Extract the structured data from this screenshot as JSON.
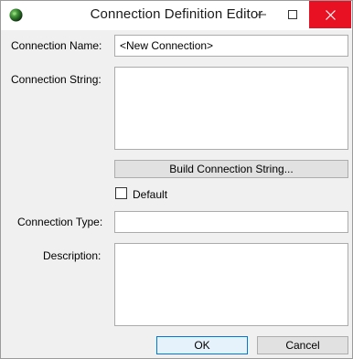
{
  "window": {
    "title": "Connection Definition Editor",
    "icon": "globe-icon",
    "close_color": "#e81123"
  },
  "form": {
    "connection_name_label": "Connection Name:",
    "connection_name_value": "<New Connection>",
    "connection_string_label": "Connection String:",
    "connection_string_value": "",
    "build_button_label": "Build Connection String...",
    "default_label": "Default",
    "default_checked": false,
    "connection_type_label": "Connection Type:",
    "connection_type_value": "",
    "description_label": "Description:",
    "description_value": ""
  },
  "buttons": {
    "ok_label": "OK",
    "cancel_label": "Cancel"
  }
}
